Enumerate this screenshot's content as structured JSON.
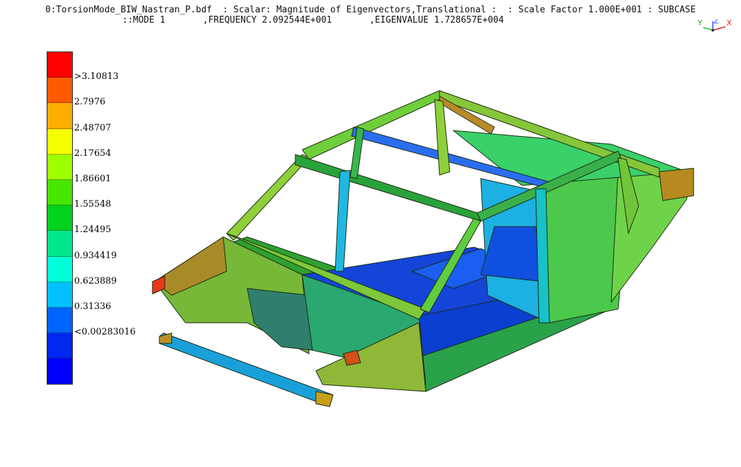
{
  "header": {
    "line1": "0:TorsionMode_BIW_Nastran_P.bdf  : Scalar: Magnitude of Eigenvectors,Translational :  : Scale Factor 1.000E+001 : SUBCASE",
    "line2": "::MODE 1       ,FREQUENCY 2.092544E+001       ,EIGENVALUE 1.728657E+004"
  },
  "triad": {
    "x": "X",
    "y": "Y",
    "z": "Z"
  },
  "legend": {
    "colors": [
      "#ff0000",
      "#ff5a00",
      "#ffae00",
      "#f5ff00",
      "#9dff00",
      "#46e600",
      "#00d21e",
      "#00e68c",
      "#00ffd8",
      "#00c0ff",
      "#0064ff",
      "#0028ee",
      "#0000ff"
    ],
    "labels": [
      ">3.10813",
      "2.7976",
      "2.48707",
      "2.17654",
      "1.86601",
      "1.55548",
      "1.24495",
      "0.934419",
      "0.623889",
      "0.31336",
      "<0.00283016"
    ]
  }
}
